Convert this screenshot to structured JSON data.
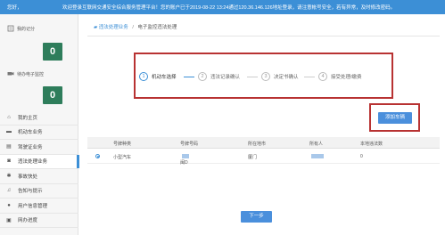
{
  "topbar": {
    "greeting": "您好，",
    "notice": "欢迎登录互联网交通安全综合服务管理平台！您的账户已于2019-08-22 13:24通过120.36.146.126地址登录，请注意帐号安全，若有异常，及时修改密码。"
  },
  "sidebar": {
    "stats": [
      {
        "label": "我的记分",
        "value": "0"
      },
      {
        "label": "待办电子监控",
        "value": "0"
      }
    ],
    "items": [
      {
        "label": "我的主页",
        "icon": "home-icon"
      },
      {
        "label": "机动车业务",
        "icon": "car-icon"
      },
      {
        "label": "驾驶证业务",
        "icon": "id-card-icon"
      },
      {
        "label": "违法处理业务",
        "icon": "camera-icon"
      },
      {
        "label": "事故快处",
        "icon": "accident-icon"
      },
      {
        "label": "告知与提示",
        "icon": "bell-icon"
      },
      {
        "label": "用户信息管理",
        "icon": "user-icon"
      },
      {
        "label": "网办进度",
        "icon": "progress-icon"
      }
    ]
  },
  "breadcrumb": {
    "parent": "违法处理业务",
    "separator": "/",
    "current": "电子监控违法处理"
  },
  "steps": [
    {
      "num": "1",
      "label": "机动车选择"
    },
    {
      "num": "2",
      "label": "违法记录确认"
    },
    {
      "num": "3",
      "label": "决定书确认"
    },
    {
      "num": "4",
      "label": "接受处理/缴费"
    }
  ],
  "buttons": {
    "add_vehicle": "添加车辆",
    "next": "下一步"
  },
  "table": {
    "headers": [
      "号牌种类",
      "号牌号码",
      "所在地市",
      "所有人",
      "本地违法数"
    ],
    "rows": [
      {
        "plate_type": "小型汽车",
        "plate_no": "闽D",
        "city": "厦门",
        "owner": "",
        "count": "0"
      }
    ]
  },
  "colors": {
    "accent": "#3c8fd6",
    "highlight_border": "#b83232",
    "badge": "#2e7d5b"
  }
}
